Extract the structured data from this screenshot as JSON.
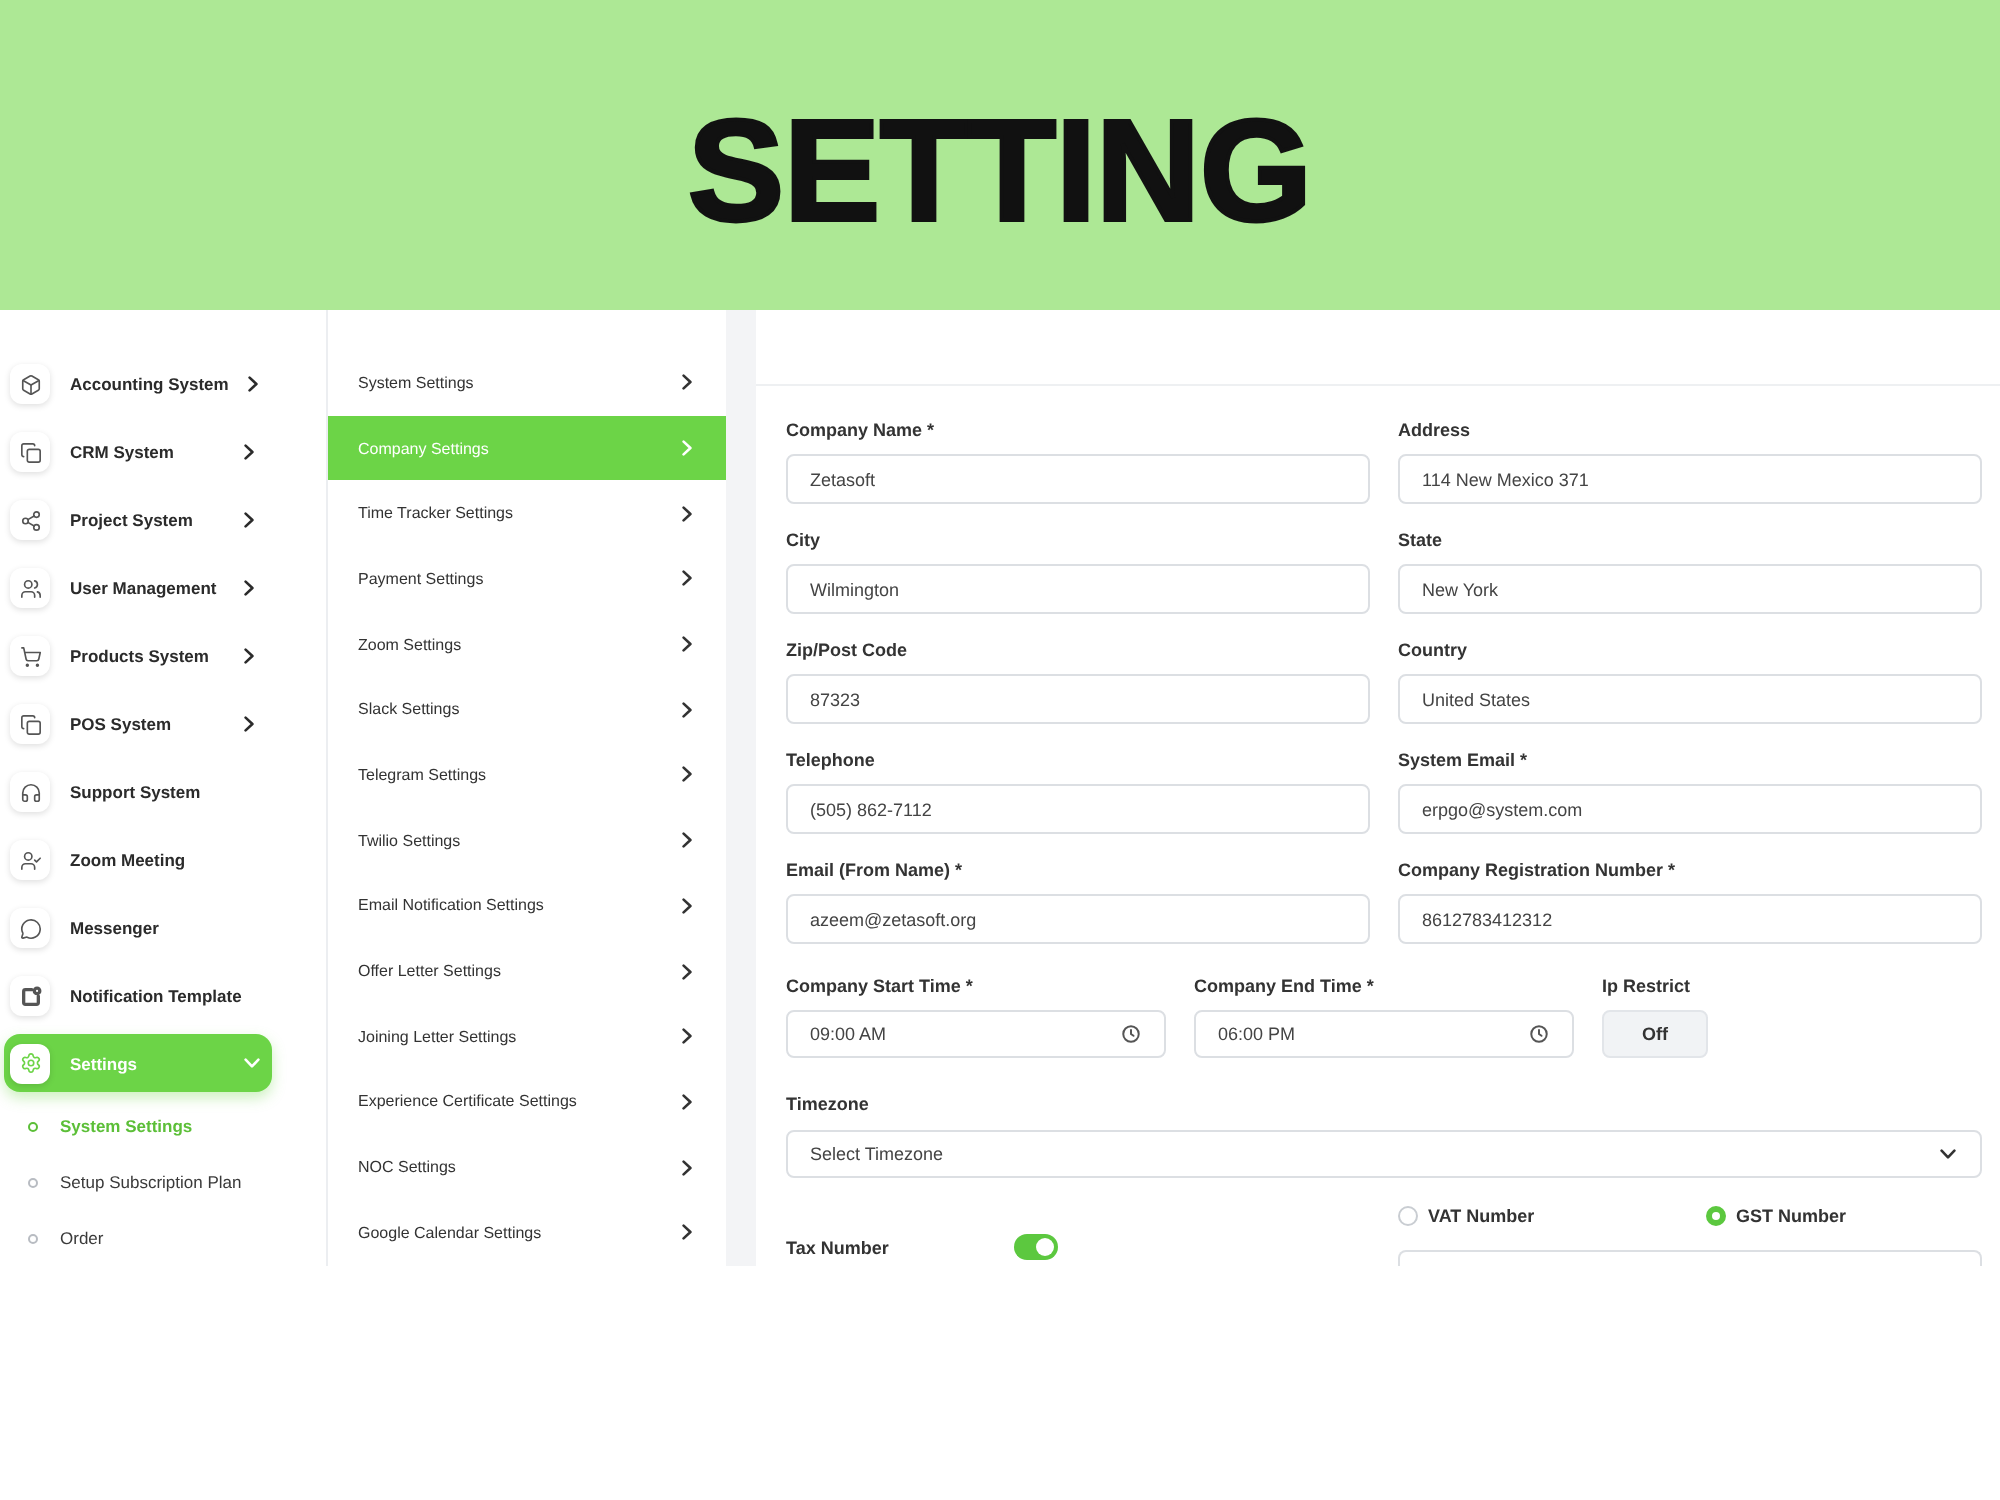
{
  "banner": {
    "title": "SETTING"
  },
  "sidebar": {
    "items": [
      {
        "label": "Accounting System",
        "expanded": false,
        "selected": false
      },
      {
        "label": "CRM System",
        "expanded": false,
        "selected": false
      },
      {
        "label": "Project System",
        "expanded": false,
        "selected": false
      },
      {
        "label": "User Management",
        "expanded": false,
        "selected": false
      },
      {
        "label": "Products System",
        "expanded": false,
        "selected": false
      },
      {
        "label": "POS System",
        "expanded": false,
        "selected": false
      },
      {
        "label": "Support System",
        "selected": false
      },
      {
        "label": "Zoom Meeting",
        "selected": false
      },
      {
        "label": "Messenger",
        "selected": false
      },
      {
        "label": "Notification Template",
        "selected": false
      },
      {
        "label": "Settings",
        "expanded": true,
        "selected": true,
        "children": [
          {
            "label": "System Settings",
            "selected": true
          },
          {
            "label": "Setup Subscription Plan",
            "selected": false
          },
          {
            "label": "Order",
            "selected": false
          }
        ]
      }
    ]
  },
  "settings_menu": {
    "items": [
      {
        "label": "System Settings",
        "selected": false
      },
      {
        "label": "Company Settings",
        "selected": true
      },
      {
        "label": "Time Tracker Settings",
        "selected": false
      },
      {
        "label": "Payment Settings",
        "selected": false
      },
      {
        "label": "Zoom Settings",
        "selected": false
      },
      {
        "label": "Slack Settings",
        "selected": false
      },
      {
        "label": "Telegram Settings",
        "selected": false
      },
      {
        "label": "Twilio Settings",
        "selected": false
      },
      {
        "label": "Email Notification Settings",
        "selected": false
      },
      {
        "label": "Offer Letter Settings",
        "selected": false
      },
      {
        "label": "Joining Letter Settings",
        "selected": false
      },
      {
        "label": "Experience Certificate Settings",
        "selected": false
      },
      {
        "label": "NOC Settings",
        "selected": false
      },
      {
        "label": "Google Calendar Settings",
        "selected": false
      }
    ]
  },
  "form": {
    "fields": [
      {
        "label": "Company Name *",
        "value": "Zetasoft"
      },
      {
        "label": "Address",
        "value": "114 New Mexico 371"
      },
      {
        "label": "City",
        "value": "Wilmington"
      },
      {
        "label": "State",
        "value": "New York"
      },
      {
        "label": "Zip/Post Code",
        "value": "87323"
      },
      {
        "label": "Country",
        "value": "United States"
      },
      {
        "label": "Telephone",
        "value": "(505) 862-7112"
      },
      {
        "label": "System Email *",
        "value": "erpgo@system.com"
      },
      {
        "label": "Email (From Name) *",
        "value": "azeem@zetasoft.org"
      },
      {
        "label": "Company Registration Number *",
        "value": "8612783412312"
      }
    ],
    "time_fields": [
      {
        "label": "Company Start Time *",
        "value": "09:00 AM"
      },
      {
        "label": "Company End Time *",
        "value": "06:00 PM"
      }
    ],
    "ip_restrict": {
      "label": "Ip Restrict",
      "button": "Off"
    },
    "timezone": {
      "label": "Timezone",
      "placeholder": "Select Timezone"
    },
    "tax": {
      "label": "Tax Number",
      "on": true,
      "options": [
        {
          "label": "VAT Number",
          "selected": false
        },
        {
          "label": "GST Number",
          "selected": true
        }
      ]
    }
  }
}
